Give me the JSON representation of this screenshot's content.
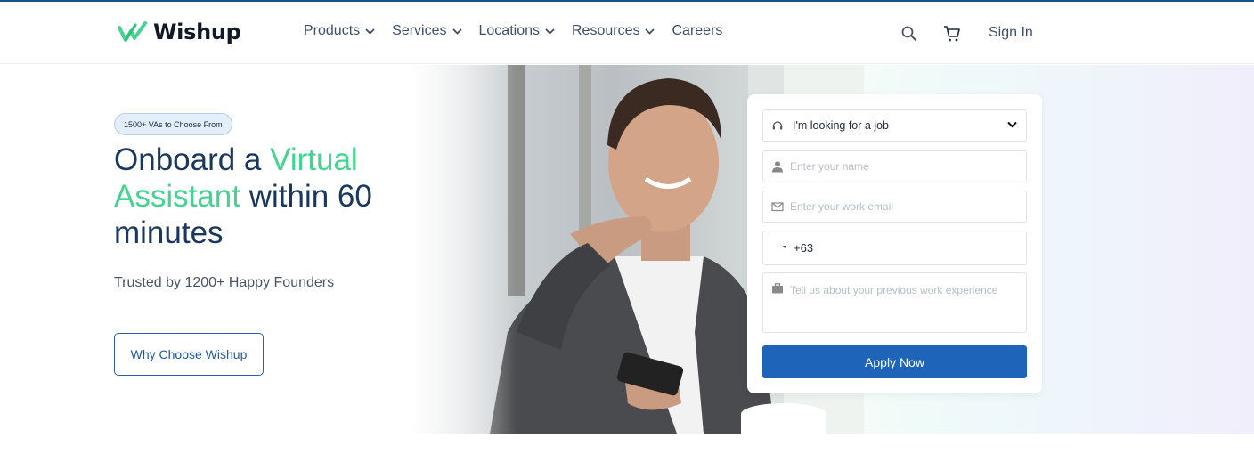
{
  "brand": {
    "name": "Wishup",
    "accent": "#45d48f",
    "primary": "#1e64b8"
  },
  "nav": {
    "items": [
      {
        "label": "Products",
        "dropdown": true
      },
      {
        "label": "Services",
        "dropdown": true
      },
      {
        "label": "Locations",
        "dropdown": true
      },
      {
        "label": "Resources",
        "dropdown": true
      },
      {
        "label": "Careers",
        "dropdown": false
      }
    ],
    "search_icon": "search-icon",
    "cart_icon": "cart-icon",
    "signin_label": "Sign In"
  },
  "hero": {
    "badge": "1500+ VAs to Choose From",
    "headline_part1": "Onboard a ",
    "headline_accent": "Virtual Assistant",
    "headline_part2": " within 60 minutes",
    "subtitle": "Trusted by 1200+ Happy Founders",
    "cta_label": "Why Choose Wishup"
  },
  "form": {
    "select_value": "I'm looking for a job",
    "name_placeholder": "Enter your name",
    "email_placeholder": "Enter your work email",
    "phone_code": "+63",
    "experience_placeholder": "Tell us about your previous work experience",
    "submit_label": "Apply Now"
  }
}
